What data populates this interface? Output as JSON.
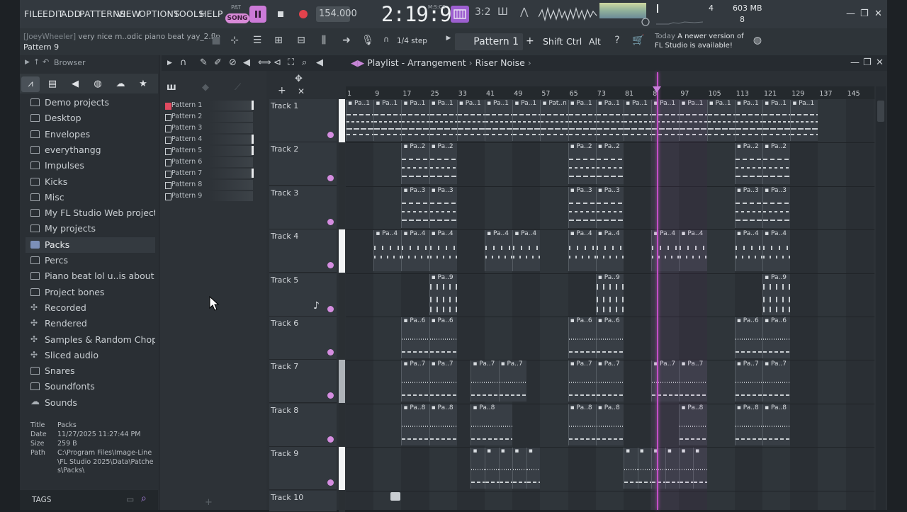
{
  "menu": [
    "FILE",
    "EDIT",
    "ADD",
    "PATTERNS",
    "VIEW",
    "OPTIONS",
    "TOOLS",
    "HELP"
  ],
  "transport": {
    "pat_label": "PAT",
    "song_label": "SONG",
    "tempo": "154.000",
    "time": "2:19:91",
    "time_unit": "M:S:CS"
  },
  "system": {
    "cpu": "4",
    "memory": "603 MB",
    "voices": "8"
  },
  "project": {
    "title_user": "[JoeyWheeler]",
    "title_file": "very nice m..odic piano beat yay_2.flp",
    "current_pattern": "Pattern 9"
  },
  "toolbar2": {
    "snap": "1/4 step",
    "pattern_select": "Pattern 1",
    "mod_keys": [
      "Shift",
      "Ctrl",
      "Alt"
    ],
    "news_today": "Today",
    "news_line1": "A newer version of",
    "news_line2": "FL Studio is available!"
  },
  "browser": {
    "title": "Browser",
    "items": [
      {
        "label": "Demo projects",
        "icon": "folder-icon"
      },
      {
        "label": "Desktop",
        "icon": "folder-icon"
      },
      {
        "label": "Envelopes",
        "icon": "folder-icon"
      },
      {
        "label": "everythangg",
        "icon": "folder-icon"
      },
      {
        "label": "Impulses",
        "icon": "folder-icon"
      },
      {
        "label": "Kicks",
        "icon": "folder-icon"
      },
      {
        "label": "Misc",
        "icon": "folder-icon"
      },
      {
        "label": "My FL Studio Web projects",
        "icon": "folder-icon"
      },
      {
        "label": "My projects",
        "icon": "folder-icon"
      },
      {
        "label": "Packs",
        "icon": "packs-icon"
      },
      {
        "label": "Percs",
        "icon": "folder-icon"
      },
      {
        "label": "Piano beat lol u..is about to die",
        "icon": "folder-icon"
      },
      {
        "label": "Project bones",
        "icon": "folder-icon"
      },
      {
        "label": "Recorded",
        "icon": "recorded-icon"
      },
      {
        "label": "Rendered",
        "icon": "rendered-icon"
      },
      {
        "label": "Samples & Random Chops",
        "icon": "samples-icon"
      },
      {
        "label": "Sliced audio",
        "icon": "sliced-icon"
      },
      {
        "label": "Snares",
        "icon": "folder-icon"
      },
      {
        "label": "Soundfonts",
        "icon": "folder-icon"
      },
      {
        "label": "Sounds",
        "icon": "cloud-icon"
      }
    ],
    "info": {
      "title_key": "Title",
      "title_val": "Packs",
      "date_key": "Date",
      "date_val": "11/27/2025 11:27:44 PM",
      "size_key": "Size",
      "size_val": "259 B",
      "path_key": "Path",
      "path_val": "C:\\Program Files\\Image-Line\\FL Studio 2025\\Data\\Patches\\Packs\\"
    },
    "tags_label": "TAGS"
  },
  "patterns": [
    "Pattern 1",
    "Pattern 2",
    "Pattern 3",
    "Pattern 4",
    "Pattern 5",
    "Pattern 6",
    "Pattern 7",
    "Pattern 8",
    "Pattern 9"
  ],
  "playlist": {
    "title": "Playlist",
    "sep": "-",
    "view": "Arrangement",
    "arrow": "›",
    "current_pattern": "Riser Noise",
    "ruler": [
      "1",
      "9",
      "17",
      "25",
      "33",
      "41",
      "49",
      "57",
      "65",
      "73",
      "81",
      "8",
      "97",
      "105",
      "113",
      "121",
      "129",
      "137",
      "145"
    ],
    "tracks": [
      "Track 1",
      "Track 2",
      "Track 3",
      "Track 4",
      "Track 5",
      "Track 6",
      "Track 7",
      "Track 8",
      "Track 9",
      "Track 10"
    ],
    "clip_labels": {
      "t1": [
        "Pa..1",
        "Pa..1",
        "Pa..1",
        "Pa..1",
        "Pa..1",
        "Pa..1",
        "Pa..1",
        "Pat..n",
        "Pa..1",
        "Pa..1",
        "Pa..1",
        "Pa..1",
        "Pa..1",
        "Pa..1",
        "Pa..1",
        "Pa..1",
        "Pa..1"
      ],
      "t2": "Pa..2",
      "t3": "Pa..3",
      "t4": "Pa..4",
      "t5": "Pa..9",
      "t6": "Pa..6",
      "t7": "Pa..7",
      "t8": "Pa..8"
    }
  },
  "colors": {
    "accent": "#c34fc8",
    "song_pill": "#d98ad8",
    "record": "#e2424c"
  }
}
